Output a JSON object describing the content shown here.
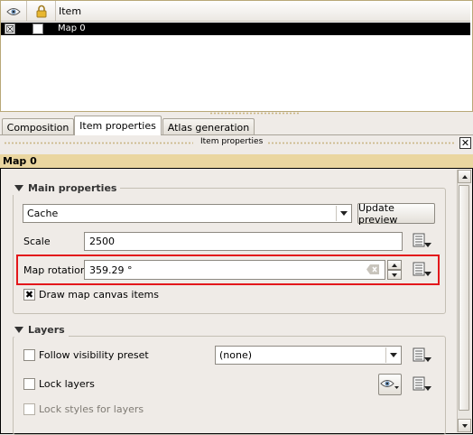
{
  "items_panel": {
    "columns": {
      "visibility_icon": "eye-icon",
      "lock_icon": "lock-icon",
      "item_label": "Item"
    },
    "rows": [
      {
        "visible": "☒",
        "locked": "",
        "name": "Map 0"
      }
    ]
  },
  "tabs": [
    {
      "label": "Composition",
      "active": false
    },
    {
      "label": "Item properties",
      "active": true
    },
    {
      "label": "Atlas generation",
      "active": false
    }
  ],
  "panel_title": "Item properties",
  "close_icon": "✕",
  "item_header": "Map 0",
  "main_properties": {
    "title": "Main properties",
    "cache_value": "Cache",
    "update_preview": "Update preview",
    "scale_label": "Scale",
    "scale_value": "2500",
    "rotation_label": "Map rotation",
    "rotation_value": "359.29 °",
    "draw_canvas_label": "Draw map canvas items",
    "draw_canvas_checked": "✖"
  },
  "layers": {
    "title": "Layers",
    "follow_preset_label": "Follow visibility preset",
    "preset_value": "(none)",
    "lock_layers_label": "Lock layers",
    "lock_styles_label": "Lock styles for layers"
  },
  "colors": {
    "highlight": "#e3171b",
    "item_header_bg": "#ead6a0",
    "selection_bg": "#000000"
  }
}
